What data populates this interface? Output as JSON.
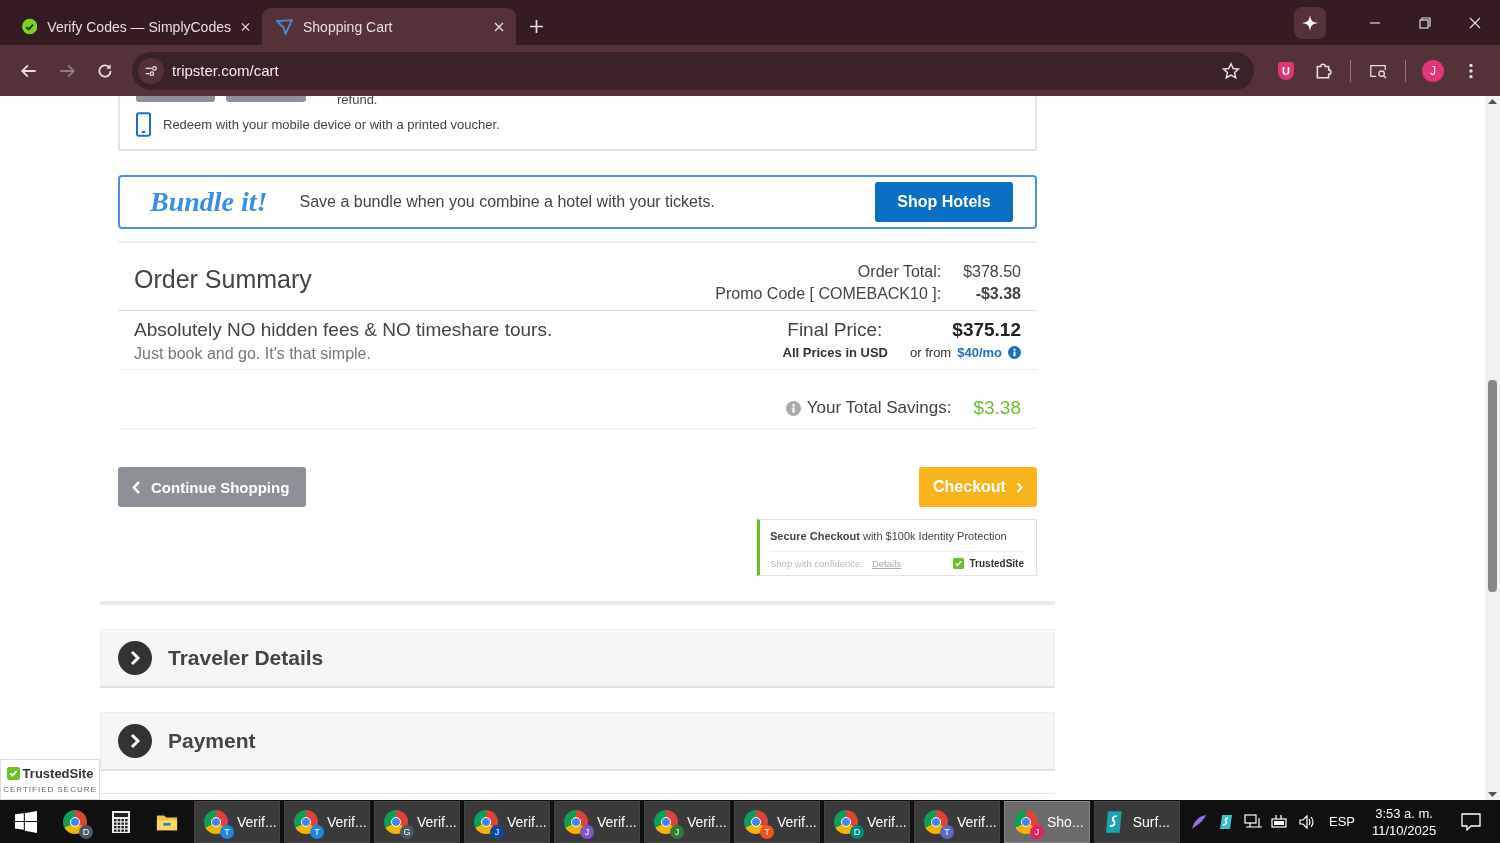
{
  "browser": {
    "tabs": [
      {
        "title": "Verify Codes — SimplyCodes",
        "selected": false
      },
      {
        "title": "Shopping Cart",
        "selected": true
      }
    ],
    "url": "tripster.com/cart",
    "profile_initial": "J",
    "shield_letter": "U"
  },
  "voucher_card": {
    "refund_text": "refund.",
    "redeem_text": "Redeem with your mobile device or with a printed voucher."
  },
  "bundle": {
    "logo": "Bundle it!",
    "text": "Save a bundle when you combine a hotel with your tickets.",
    "button": "Shop Hotels"
  },
  "order_summary": {
    "title": "Order Summary",
    "order_total_label": "Order Total:",
    "order_total": "$378.50",
    "promo_label": "Promo Code [ COMEBACK10 ]:",
    "promo_value": "-$3.38",
    "tagline": "Absolutely NO hidden fees & NO timeshare tours.",
    "subtagline": "Just book and go. It's that simple.",
    "final_label": "Final Price:",
    "final_price": "$375.12",
    "currency_note": "All Prices in USD",
    "financing_prefix": "or from",
    "financing_link": "$40/mo",
    "savings_label": "Your Total Savings:",
    "savings_value": "$3.38"
  },
  "actions": {
    "continue": "Continue Shopping",
    "checkout": "Checkout"
  },
  "secure_badge": {
    "headline": "**Secure Checkout** with $100k Identity Protection",
    "confidence": "Shop with confidence.",
    "details": "Details",
    "brand": "TrustedSite"
  },
  "sections": [
    {
      "title": "Traveler Details",
      "expanded": false
    },
    {
      "title": "Payment",
      "expanded": false
    }
  ],
  "trust_seal": {
    "brand": "TrustedSite",
    "caption": "CERTIFIED SECURE"
  },
  "taskbar": {
    "pinned": [
      {
        "kind": "chrome",
        "badge": "D",
        "color": "#455a64"
      },
      {
        "kind": "calculator"
      },
      {
        "kind": "folder"
      }
    ],
    "tasks": [
      {
        "kind": "chrome",
        "label": "Verif...",
        "badge": "T",
        "color": "#1e88e5",
        "selected": false
      },
      {
        "kind": "chrome",
        "label": "Verif...",
        "badge": "T",
        "color": "#1e88e5",
        "selected": false
      },
      {
        "kind": "chrome",
        "label": "Verif...",
        "badge": "G",
        "color": "#455a64",
        "selected": false
      },
      {
        "kind": "chrome",
        "label": "Verif...",
        "badge": "J",
        "color": "#0d47a1",
        "selected": false
      },
      {
        "kind": "chrome",
        "label": "Verif...",
        "badge": "J",
        "color": "#7e57c2",
        "selected": false
      },
      {
        "kind": "chrome",
        "label": "Verif...",
        "badge": "J",
        "color": "#2e7d32",
        "selected": false
      },
      {
        "kind": "chrome",
        "label": "Verif...",
        "badge": "T",
        "color": "#f4511e",
        "selected": false
      },
      {
        "kind": "chrome",
        "label": "Verif...",
        "badge": "D",
        "color": "#00897b",
        "selected": false
      },
      {
        "kind": "chrome",
        "label": "Verif...",
        "badge": "T",
        "color": "#5c6bc0",
        "selected": false
      },
      {
        "kind": "chrome",
        "label": "Sho...",
        "badge": "J",
        "color": "#e91e63",
        "selected": true
      },
      {
        "kind": "surfshark",
        "label": "Surf...",
        "selected": false
      }
    ],
    "language": "ESP",
    "time": "3:53 a. m.",
    "date": "11/10/2025"
  }
}
